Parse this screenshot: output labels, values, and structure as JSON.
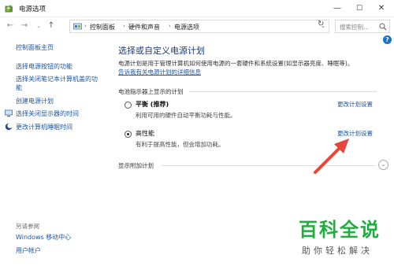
{
  "window": {
    "title": "电源选项"
  },
  "address": {
    "crumbs": [
      "控制面板",
      "硬件和声音",
      "电源选项"
    ],
    "search_placeholder": "搜索控制..."
  },
  "sidebar": {
    "links": [
      "控制面板主页",
      "选择电源按钮的功能",
      "选择关闭笔记本计算机盖的功",
      "能",
      "创建电源计划",
      "选择关闭显示器的时间",
      "更改计算机睡眠时间"
    ],
    "see_also_label": "另请参阅",
    "see_also_links": [
      "Windows 移动中心",
      "用户帐户"
    ]
  },
  "main": {
    "title": "选择或自定义电源计划",
    "description": "电源计划是用于管理计算机如何使用电源的一套硬件和系统设置(如显示器亮度、睡眠等)。",
    "description_link": "告诉我有关电源计划的详细信息",
    "group_label": "电池指示器上显示的计划",
    "plans": [
      {
        "name": "平衡 (推荐)",
        "description": "利用可用的硬件自动平衡功耗与性能。",
        "change_label": "更改计划设置",
        "selected": false
      },
      {
        "name": "高性能",
        "description": "有利于提高性能，但会增加功耗。",
        "change_label": "更改计划设置",
        "selected": true
      }
    ],
    "extra_plans_label": "显示附加计划"
  },
  "watermark": {
    "big": "百科全说",
    "small": "助你轻松解决"
  },
  "colors": {
    "link": "#1a56a8",
    "title": "#1a3a7a",
    "annotation": "#e8453c",
    "watermark": "#1fae3e"
  }
}
